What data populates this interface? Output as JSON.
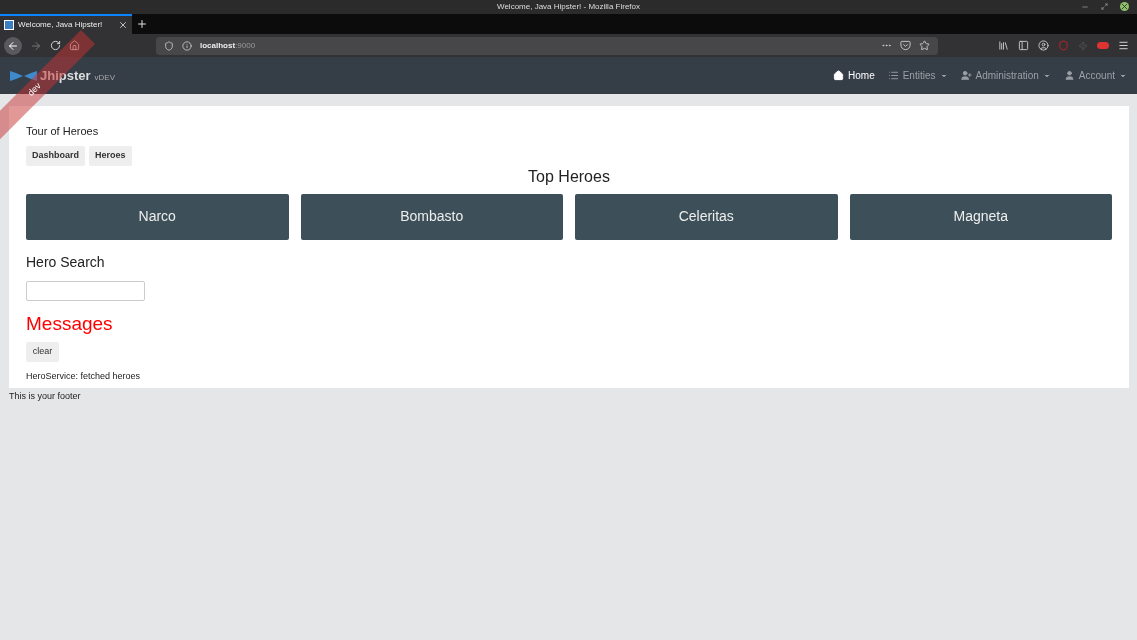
{
  "window": {
    "title": "Welcome, Java Hipster! - Mozilla Firefox"
  },
  "browser_tabs": [
    {
      "label": "Welcome, Java Hipster!",
      "selected": true
    }
  ],
  "address_bar": {
    "host": "localhost",
    "port": ":9000"
  },
  "navbar": {
    "brand": "Jhipster",
    "version": "vDEV",
    "ribbon": "dev",
    "items": [
      {
        "label": "Home",
        "selected": true,
        "dropdown": false
      },
      {
        "label": "Entities",
        "selected": false,
        "dropdown": true
      },
      {
        "label": "Administration",
        "selected": false,
        "dropdown": true
      },
      {
        "label": "Account",
        "selected": false,
        "dropdown": true
      }
    ]
  },
  "app": {
    "title": "Tour of Heroes",
    "nav_links": [
      "Dashboard",
      "Heroes"
    ],
    "top_heroes_heading": "Top Heroes",
    "top_heroes": [
      "Narco",
      "Bombasto",
      "Celeritas",
      "Magneta"
    ],
    "search_heading": "Hero Search",
    "messages_heading": "Messages",
    "clear_button": "clear",
    "messages": [
      "HeroService: fetched heroes"
    ]
  },
  "footer": "This is your footer"
}
